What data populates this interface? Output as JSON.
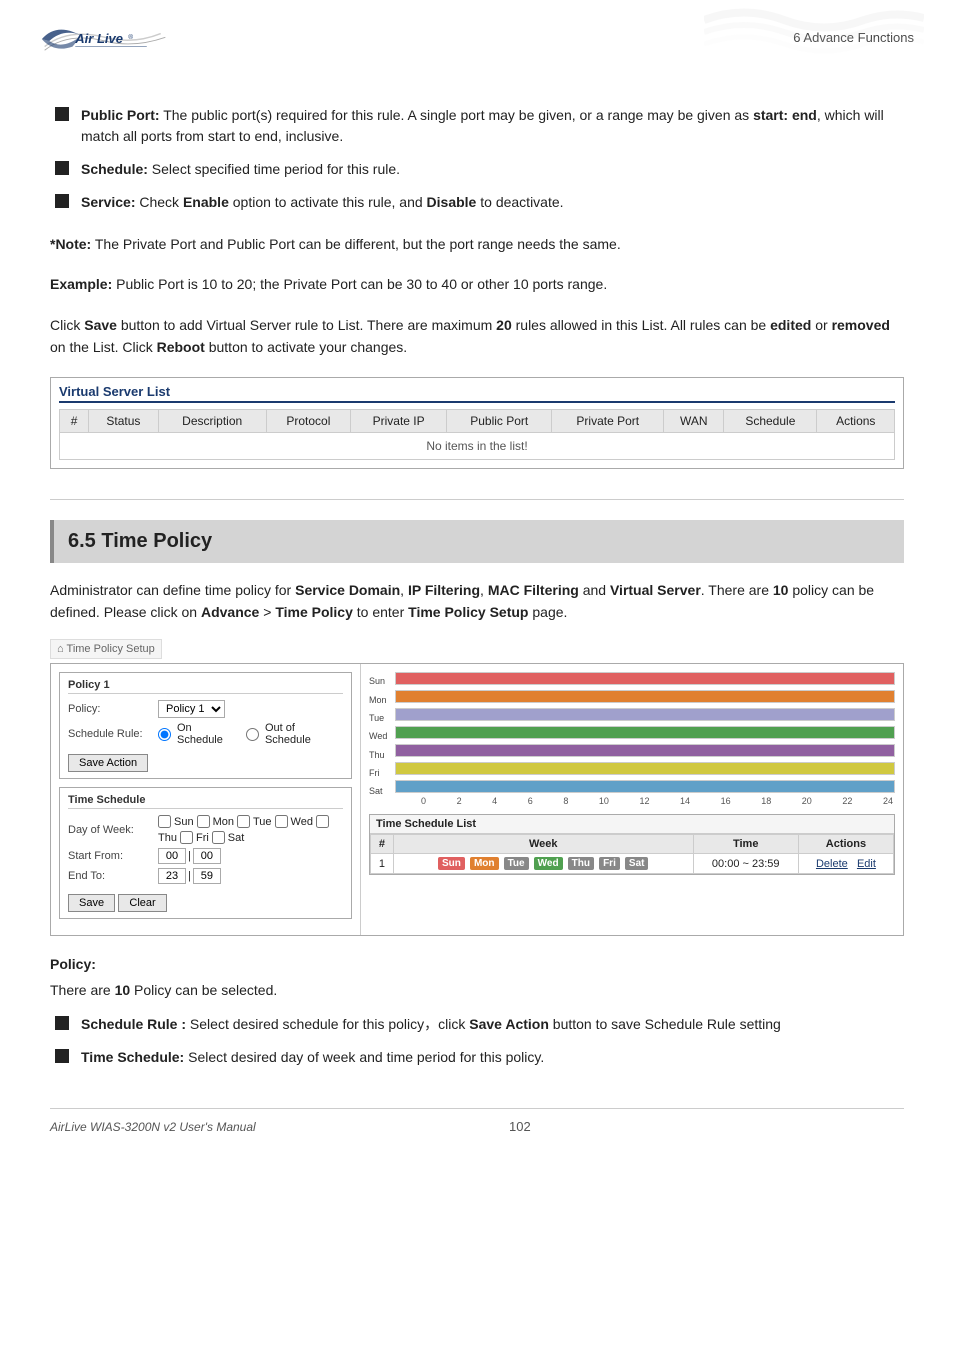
{
  "header": {
    "chapter": "6 Advance Functions",
    "logo_text": "Air Live",
    "logo_reg": "®"
  },
  "bullets": [
    {
      "term": "Public Port:",
      "desc": " The public port(s) required for this rule. A single port may be given, or a range may be given as ",
      "bold_mid": "start: end",
      "desc2": ", which will match all ports from start to end, inclusive."
    },
    {
      "term": "Schedule:",
      "desc": " Select specified time period for this rule."
    },
    {
      "term": "Service:",
      "desc": " Check ",
      "bold_mid": "Enable",
      "desc2": " option to activate this rule, and ",
      "bold_end": "Disable",
      "desc3": " to deactivate."
    }
  ],
  "note": {
    "label": "*Note:",
    "text": " The Private Port and Public Port can be different, but the port range needs the same."
  },
  "example": {
    "label": "Example:",
    "text": " Public Port is 10 to 20; the Private Port can be 30 to 40 or other 10 ports range."
  },
  "click_save": {
    "text1": "Click ",
    "bold1": "Save",
    "text2": " button to add Virtual Server rule to List. There are maximum ",
    "bold2": "20",
    "text3": " rules allowed in this List. All rules can be ",
    "bold3": "edited",
    "text4": " or ",
    "bold4": "removed",
    "text5": " on the List. Click ",
    "bold5": "Reboot",
    "text6": " button to activate your changes."
  },
  "vs_list": {
    "title": "Virtual Server List",
    "columns": [
      "#",
      "Status",
      "Description",
      "Protocol",
      "Private IP",
      "Public Port",
      "Private Port",
      "WAN",
      "Schedule",
      "Actions"
    ],
    "empty_text": "No items in the list!"
  },
  "section_65": {
    "title": "6.5 Time Policy"
  },
  "section_65_intro": {
    "text1": "Administrator can define time policy for ",
    "bold1": "Service Domain",
    "text2": ", ",
    "bold2": "IP Filtering",
    "text3": ", ",
    "bold3": "MAC Filtering",
    "text4": " and ",
    "bold4": "Virtual Server",
    "text5": ". There are ",
    "bold5": "10",
    "text6": " policy can be defined. Please click on ",
    "bold6": "Advance",
    "text7": " > ",
    "bold7": "Time Policy",
    "text8": " to enter ",
    "bold8": "Time Policy Setup",
    "text9": " page."
  },
  "tps": {
    "breadcrumb": "Time Policy Setup",
    "policy1_box": {
      "title": "Policy 1",
      "policy_label": "Policy:",
      "policy_value": "Policy 1",
      "schedule_rule_label": "Schedule Rule:",
      "on_schedule": "On Schedule",
      "out_of_schedule": "Out of Schedule",
      "save_action_btn": "Save Action"
    },
    "time_schedule_box": {
      "title": "Time Schedule",
      "day_of_week_label": "Day of Week:",
      "days": [
        "Sun",
        "Mon",
        "Tue",
        "Wed",
        "Thu",
        "Fri",
        "Sat"
      ],
      "start_from_label": "Start From:",
      "start_h": "00",
      "start_m": "00",
      "end_to_label": "End To:",
      "end_h": "23",
      "end_m": "59",
      "save_btn": "Save",
      "clear_btn": "Clear"
    },
    "chart": {
      "y_labels": [
        "Sun",
        "Mon",
        "Tue",
        "Wed",
        "Thu",
        "Fri",
        "Sat"
      ],
      "x_labels": [
        "0",
        "2",
        "4",
        "6",
        "8",
        "10",
        "12",
        "14",
        "16",
        "18",
        "20",
        "22",
        "24"
      ],
      "bars": [
        {
          "day": "Sun",
          "color": "#e06060",
          "width": "100"
        },
        {
          "day": "Mon",
          "color": "#e08030",
          "width": "100"
        },
        {
          "day": "Tue",
          "color": "#a0a0d0",
          "width": "100"
        },
        {
          "day": "Wed",
          "color": "#50a050",
          "width": "100"
        },
        {
          "day": "Thu",
          "color": "#9060a0",
          "width": "100"
        },
        {
          "day": "Fri",
          "color": "#d0d060",
          "width": "100"
        },
        {
          "day": "Sat",
          "color": "#60a0d0",
          "width": "100"
        }
      ]
    },
    "ts_list": {
      "title": "Time Schedule List",
      "columns": [
        "#",
        "Week",
        "Time",
        "Actions"
      ],
      "rows": [
        {
          "num": "1",
          "days": [
            "Sun",
            "Mon",
            "Wed",
            "Fri",
            "Sat"
          ],
          "time": "00:00 ~ 23:59",
          "actions": [
            "Delete",
            "Edit"
          ]
        }
      ]
    }
  },
  "policy_section": {
    "title": "Policy:",
    "ten_text": "There are ",
    "ten_bold": "10",
    "ten_rest": " Policy can be selected."
  },
  "policy_bullets": [
    {
      "term": "Schedule Rule :",
      "desc": " Select desired schedule for this policy，click ",
      "bold": "Save Action",
      "desc2": " button to save Schedule Rule setting"
    },
    {
      "term": "Time Schedule:",
      "desc": " Select desired day of week and time period for this policy."
    }
  ],
  "footer": {
    "left": "AirLive WIAS-3200N v2 User's Manual",
    "page": "102"
  }
}
